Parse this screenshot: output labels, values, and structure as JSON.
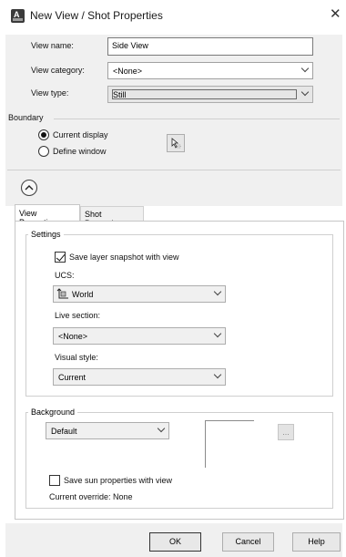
{
  "window": {
    "title": "New View / Shot Properties",
    "close_glyph": "✕",
    "app_icon": "autocad-icon"
  },
  "form": {
    "view_name_label": "View name:",
    "view_name_value": "Side View",
    "view_category_label": "View category:",
    "view_category_value": "<None>",
    "view_type_label": "View type:",
    "view_type_value": "Still"
  },
  "boundary": {
    "label": "Boundary",
    "current_display": "Current display",
    "define_window": "Define window",
    "selected": "current_display",
    "pick_icon": "pick-window-icon"
  },
  "collapse": {
    "icon": "chevron-up-circle-icon"
  },
  "tabs": [
    {
      "label": "View Properties",
      "active": true
    },
    {
      "label": "Shot Properties",
      "active": false
    }
  ],
  "settings": {
    "legend": "Settings",
    "save_layer_snapshot": "Save layer snapshot with view",
    "save_layer_snapshot_checked": true,
    "ucs_label": "UCS:",
    "ucs_value": "World",
    "ucs_icon": "ucs-world-icon",
    "live_section_label": "Live section:",
    "live_section_value": "<None>",
    "visual_style_label": "Visual style:",
    "visual_style_value": "Current"
  },
  "background": {
    "legend": "Background",
    "value": "Default",
    "browse_label": "...",
    "save_sun": "Save sun properties with view",
    "save_sun_checked": false,
    "current_override": "Current override: None"
  },
  "buttons": {
    "ok": "OK",
    "cancel": "Cancel",
    "help": "Help"
  },
  "colors": {
    "dialog_bg": "#f0f0f0",
    "panel_bg": "#ffffff",
    "border": "#adadad"
  }
}
